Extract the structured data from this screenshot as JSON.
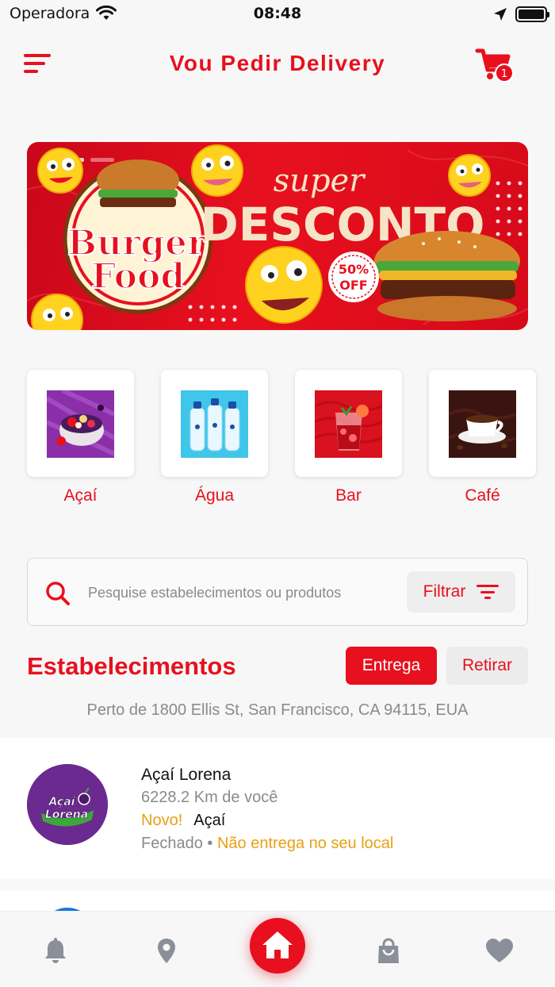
{
  "status_bar": {
    "carrier": "Operadora",
    "time": "08:48"
  },
  "header": {
    "title": "Vou Pedir Delivery",
    "cart_count": "1"
  },
  "banner": {
    "brand_line1": "Burger",
    "brand_line2": "Food",
    "headline_top": "super",
    "headline_main": "DESCONTO",
    "badge_value": "50%",
    "badge_label": "OFF"
  },
  "categories": [
    {
      "label": "Açaí"
    },
    {
      "label": "Água"
    },
    {
      "label": "Bar"
    },
    {
      "label": "Café"
    }
  ],
  "search": {
    "placeholder": "Pesquise estabelecimentos ou produtos",
    "filter_label": "Filtrar"
  },
  "section": {
    "title": "Estabelecimentos",
    "delivery_label": "Entrega",
    "pickup_label": "Retirar",
    "location": "Perto de 1800 Ellis St, San Francisco, CA 94115, EUA"
  },
  "stores": [
    {
      "name": "Açaí Lorena",
      "logo_line1": "Açaí",
      "logo_line2": "Lorena",
      "distance": "6228.2 Km de você",
      "tag_new": "Novo!",
      "category": "Açaí",
      "status": "Fechado",
      "separator": "•",
      "delivery_note": "Não entrega no seu local"
    }
  ],
  "colors": {
    "brand": "#e8101e",
    "accent_warning": "#e8a015"
  }
}
